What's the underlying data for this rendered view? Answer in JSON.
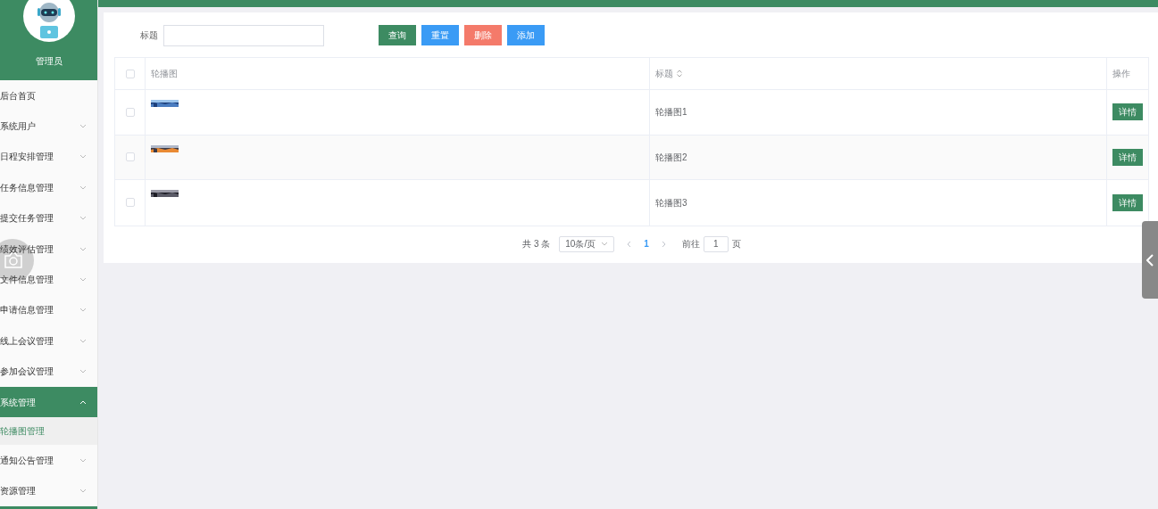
{
  "sidebar": {
    "user": "管理员",
    "items": [
      {
        "label": "后台首页",
        "expandable": false,
        "expanded": false
      },
      {
        "label": "系统用户",
        "expandable": true,
        "expanded": false
      },
      {
        "label": "日程安排管理",
        "expandable": true,
        "expanded": false
      },
      {
        "label": "任务信息管理",
        "expandable": true,
        "expanded": false
      },
      {
        "label": "提交任务管理",
        "expandable": true,
        "expanded": false
      },
      {
        "label": "绩效评估管理",
        "expandable": true,
        "expanded": false
      },
      {
        "label": "文件信息管理",
        "expandable": true,
        "expanded": false
      },
      {
        "label": "申请信息管理",
        "expandable": true,
        "expanded": false
      },
      {
        "label": "线上会议管理",
        "expandable": true,
        "expanded": false
      },
      {
        "label": "参加会议管理",
        "expandable": true,
        "expanded": false
      },
      {
        "label": "系统管理",
        "expandable": true,
        "expanded": true,
        "children": [
          {
            "label": "轮播图管理",
            "selected": true
          }
        ]
      },
      {
        "label": "通知公告管理",
        "expandable": true,
        "expanded": false
      },
      {
        "label": "资源管理",
        "expandable": true,
        "expanded": false
      }
    ]
  },
  "search": {
    "label": "标题",
    "buttons": [
      {
        "label": "查询",
        "kind": "query"
      },
      {
        "label": "重置",
        "kind": "reset"
      },
      {
        "label": "删除",
        "kind": "delete"
      },
      {
        "label": "添加",
        "kind": "add"
      }
    ]
  },
  "table": {
    "all_checked": false,
    "columns": [
      "轮播图",
      "标题",
      "操作"
    ],
    "rows": [
      {
        "checked": false,
        "title": "轮播图1",
        "action": "详情"
      },
      {
        "checked": false,
        "title": "轮播图2",
        "action": "详情"
      },
      {
        "checked": false,
        "title": "轮播图3",
        "action": "详情"
      }
    ]
  },
  "pagination": {
    "total": "共 3 条",
    "page_size": "10条/页",
    "pages": [
      {
        "label": "1",
        "selected": true
      }
    ],
    "goto_label": "前往",
    "goto_value": "1",
    "page_suffix": "页"
  }
}
